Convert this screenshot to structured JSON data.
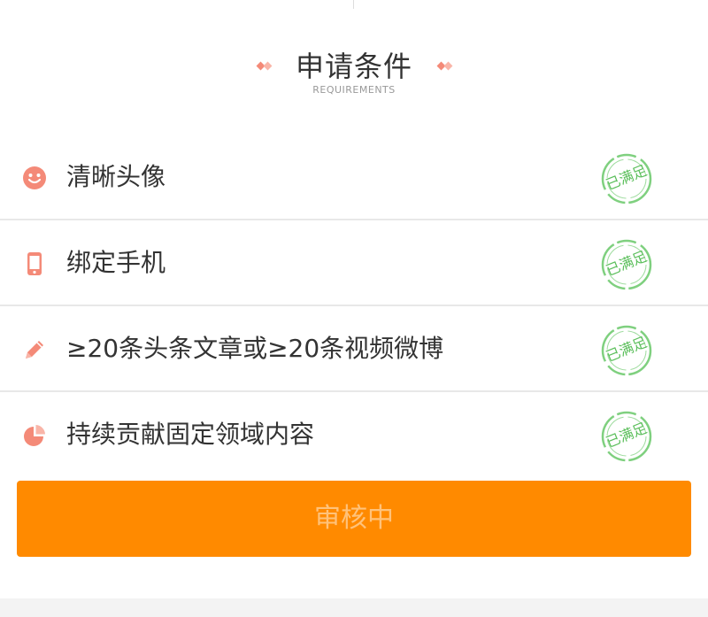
{
  "header": {
    "title": "申请条件",
    "subtitle": "REQUIREMENTS"
  },
  "requirements": [
    {
      "icon": "smiley-face-icon",
      "label": "清晰头像",
      "status": "已满足"
    },
    {
      "icon": "mobile-phone-icon",
      "label": "绑定手机",
      "status": "已满足"
    },
    {
      "icon": "pencil-icon",
      "label": "≥20条头条文章或≥20条视频微博",
      "status": "已满足"
    },
    {
      "icon": "pie-chart-icon",
      "label": "持续贡献固定领域内容",
      "status": "已满足"
    }
  ],
  "submit": {
    "label": "审核中",
    "state": "disabled"
  },
  "colors": {
    "accent": "#ff8a00",
    "icon": "#f48a78",
    "stamp": "#5cbf5c",
    "text": "#333333"
  }
}
